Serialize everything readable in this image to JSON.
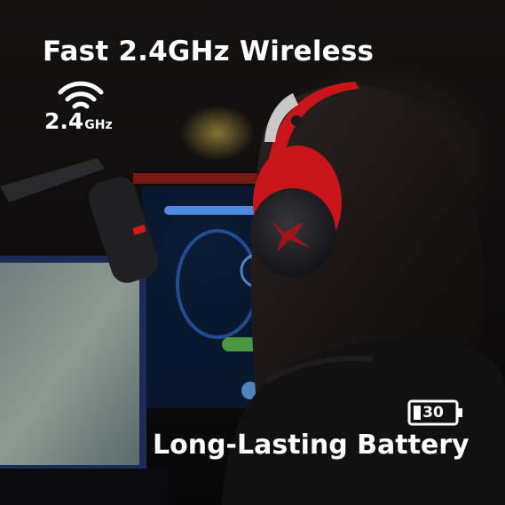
{
  "headline": "Fast 2.4GHz Wireless",
  "wireless_badge": {
    "icon": "wifi-icon",
    "value": "2.4",
    "unit": "GHz"
  },
  "battery_badge": {
    "icon": "battery-icon",
    "value": "30"
  },
  "battery_caption": "Long-Lasting Battery",
  "colors": {
    "text": "#ffffff",
    "headset_red": "#c8141b",
    "headset_black": "#1a1a1c"
  }
}
